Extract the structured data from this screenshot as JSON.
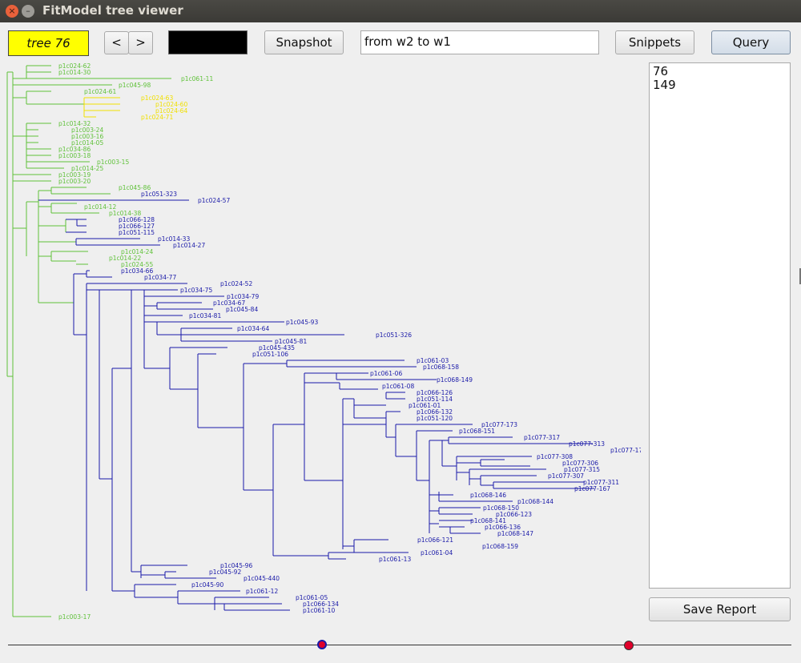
{
  "window": {
    "title": "FitModel tree viewer",
    "close_glyph": "×",
    "minimize_glyph": "–"
  },
  "toolbar": {
    "tree_label": "tree 76",
    "prev_label": "<",
    "next_label": ">",
    "swatch_color": "#000000",
    "snapshot_label": "Snapshot",
    "query_input_value": "from w2 to w1",
    "snippets_label": "Snippets",
    "query_label": "Query"
  },
  "results": {
    "items": [
      "76",
      "149"
    ]
  },
  "save_report_label": "Save Report",
  "colors": {
    "green": "#5fc139",
    "yellow": "#f0e000",
    "blue": "#1a1aa8"
  },
  "tree_labels": [
    {
      "text": "p1c024-62",
      "c": "g"
    },
    {
      "text": "p1c014-30",
      "c": "g"
    },
    {
      "text": "p1c061-11",
      "c": "g"
    },
    {
      "text": "p1c045-98",
      "c": "g"
    },
    {
      "text": "p1c024-61",
      "c": "g"
    },
    {
      "text": "p1c024-63",
      "c": "y"
    },
    {
      "text": "p1c024-60",
      "c": "y"
    },
    {
      "text": "p1c024-64",
      "c": "y"
    },
    {
      "text": "p1c024-71",
      "c": "y"
    },
    {
      "text": "p1c014-32",
      "c": "g"
    },
    {
      "text": "p1c003-24",
      "c": "g"
    },
    {
      "text": "p1c003-16",
      "c": "g"
    },
    {
      "text": "p1c014-05",
      "c": "g"
    },
    {
      "text": "p1c034-86",
      "c": "g"
    },
    {
      "text": "p1c003-18",
      "c": "g"
    },
    {
      "text": "p1c003-15",
      "c": "g"
    },
    {
      "text": "p1c014-25",
      "c": "g"
    },
    {
      "text": "p1c003-19",
      "c": "g"
    },
    {
      "text": "p1c003-20",
      "c": "g"
    },
    {
      "text": "p1c045-86",
      "c": "g"
    },
    {
      "text": "p1c051-323",
      "c": "b"
    },
    {
      "text": "p1c024-57",
      "c": "b"
    },
    {
      "text": "p1c014-12",
      "c": "g"
    },
    {
      "text": "p1c014-38",
      "c": "g"
    },
    {
      "text": "p1c066-128",
      "c": "b"
    },
    {
      "text": "p1c066-127",
      "c": "b"
    },
    {
      "text": "p1c051-115",
      "c": "b"
    },
    {
      "text": "p1c014-33",
      "c": "b"
    },
    {
      "text": "p1c014-27",
      "c": "b"
    },
    {
      "text": "p1c014-24",
      "c": "g"
    },
    {
      "text": "p1c014-22",
      "c": "g"
    },
    {
      "text": "p1c024-55",
      "c": "g"
    },
    {
      "text": "p1c034-66",
      "c": "b"
    },
    {
      "text": "p1c034-77",
      "c": "b"
    },
    {
      "text": "p1c024-52",
      "c": "b"
    },
    {
      "text": "p1c034-75",
      "c": "b"
    },
    {
      "text": "p1c034-79",
      "c": "b"
    },
    {
      "text": "p1c034-67",
      "c": "b"
    },
    {
      "text": "p1c045-84",
      "c": "b"
    },
    {
      "text": "p1c034-81",
      "c": "b"
    },
    {
      "text": "p1c045-93",
      "c": "b"
    },
    {
      "text": "p1c034-64",
      "c": "b"
    },
    {
      "text": "p1c051-326",
      "c": "b"
    },
    {
      "text": "p1c045-81",
      "c": "b"
    },
    {
      "text": "p1c045-435",
      "c": "b"
    },
    {
      "text": "p1c051-106",
      "c": "b"
    },
    {
      "text": "p1c061-03",
      "c": "b"
    },
    {
      "text": "p1c068-158",
      "c": "b"
    },
    {
      "text": "p1c061-06",
      "c": "b"
    },
    {
      "text": "p1c068-149",
      "c": "b"
    },
    {
      "text": "p1c061-08",
      "c": "b"
    },
    {
      "text": "p1c066-126",
      "c": "b"
    },
    {
      "text": "p1c051-114",
      "c": "b"
    },
    {
      "text": "p1c061-01",
      "c": "b"
    },
    {
      "text": "p1c066-132",
      "c": "b"
    },
    {
      "text": "p1c051-120",
      "c": "b"
    },
    {
      "text": "p1c077-173",
      "c": "b"
    },
    {
      "text": "p1c068-151",
      "c": "b"
    },
    {
      "text": "p1c077-317",
      "c": "b"
    },
    {
      "text": "p1c077-313",
      "c": "b"
    },
    {
      "text": "p1c077-176",
      "c": "b"
    },
    {
      "text": "p1c077-308",
      "c": "b"
    },
    {
      "text": "p1c077-306",
      "c": "b"
    },
    {
      "text": "p1c077-315",
      "c": "b"
    },
    {
      "text": "p1c077-307",
      "c": "b"
    },
    {
      "text": "p1c077-311",
      "c": "b"
    },
    {
      "text": "p1c077-167",
      "c": "b"
    },
    {
      "text": "p1c068-146",
      "c": "b"
    },
    {
      "text": "p1c068-144",
      "c": "b"
    },
    {
      "text": "p1c068-150",
      "c": "b"
    },
    {
      "text": "p1c066-123",
      "c": "b"
    },
    {
      "text": "p1c068-141",
      "c": "b"
    },
    {
      "text": "p1c066-136",
      "c": "b"
    },
    {
      "text": "p1c068-147",
      "c": "b"
    },
    {
      "text": "p1c066-121",
      "c": "b"
    },
    {
      "text": "p1c068-159",
      "c": "b"
    },
    {
      "text": "p1c061-04",
      "c": "b"
    },
    {
      "text": "p1c061-13",
      "c": "b"
    },
    {
      "text": "p1c045-96",
      "c": "b"
    },
    {
      "text": "p1c045-92",
      "c": "b"
    },
    {
      "text": "p1c045-440",
      "c": "b"
    },
    {
      "text": "p1c045-90",
      "c": "b"
    },
    {
      "text": "p1c061-12",
      "c": "b"
    },
    {
      "text": "p1c061-05",
      "c": "b"
    },
    {
      "text": "p1c066-134",
      "c": "b"
    },
    {
      "text": "p1c061-10",
      "c": "b"
    },
    {
      "text": "p1c003-17",
      "c": "g"
    }
  ],
  "slider": {
    "handle_colors": [
      "#e0002a",
      "#e0002a"
    ]
  }
}
